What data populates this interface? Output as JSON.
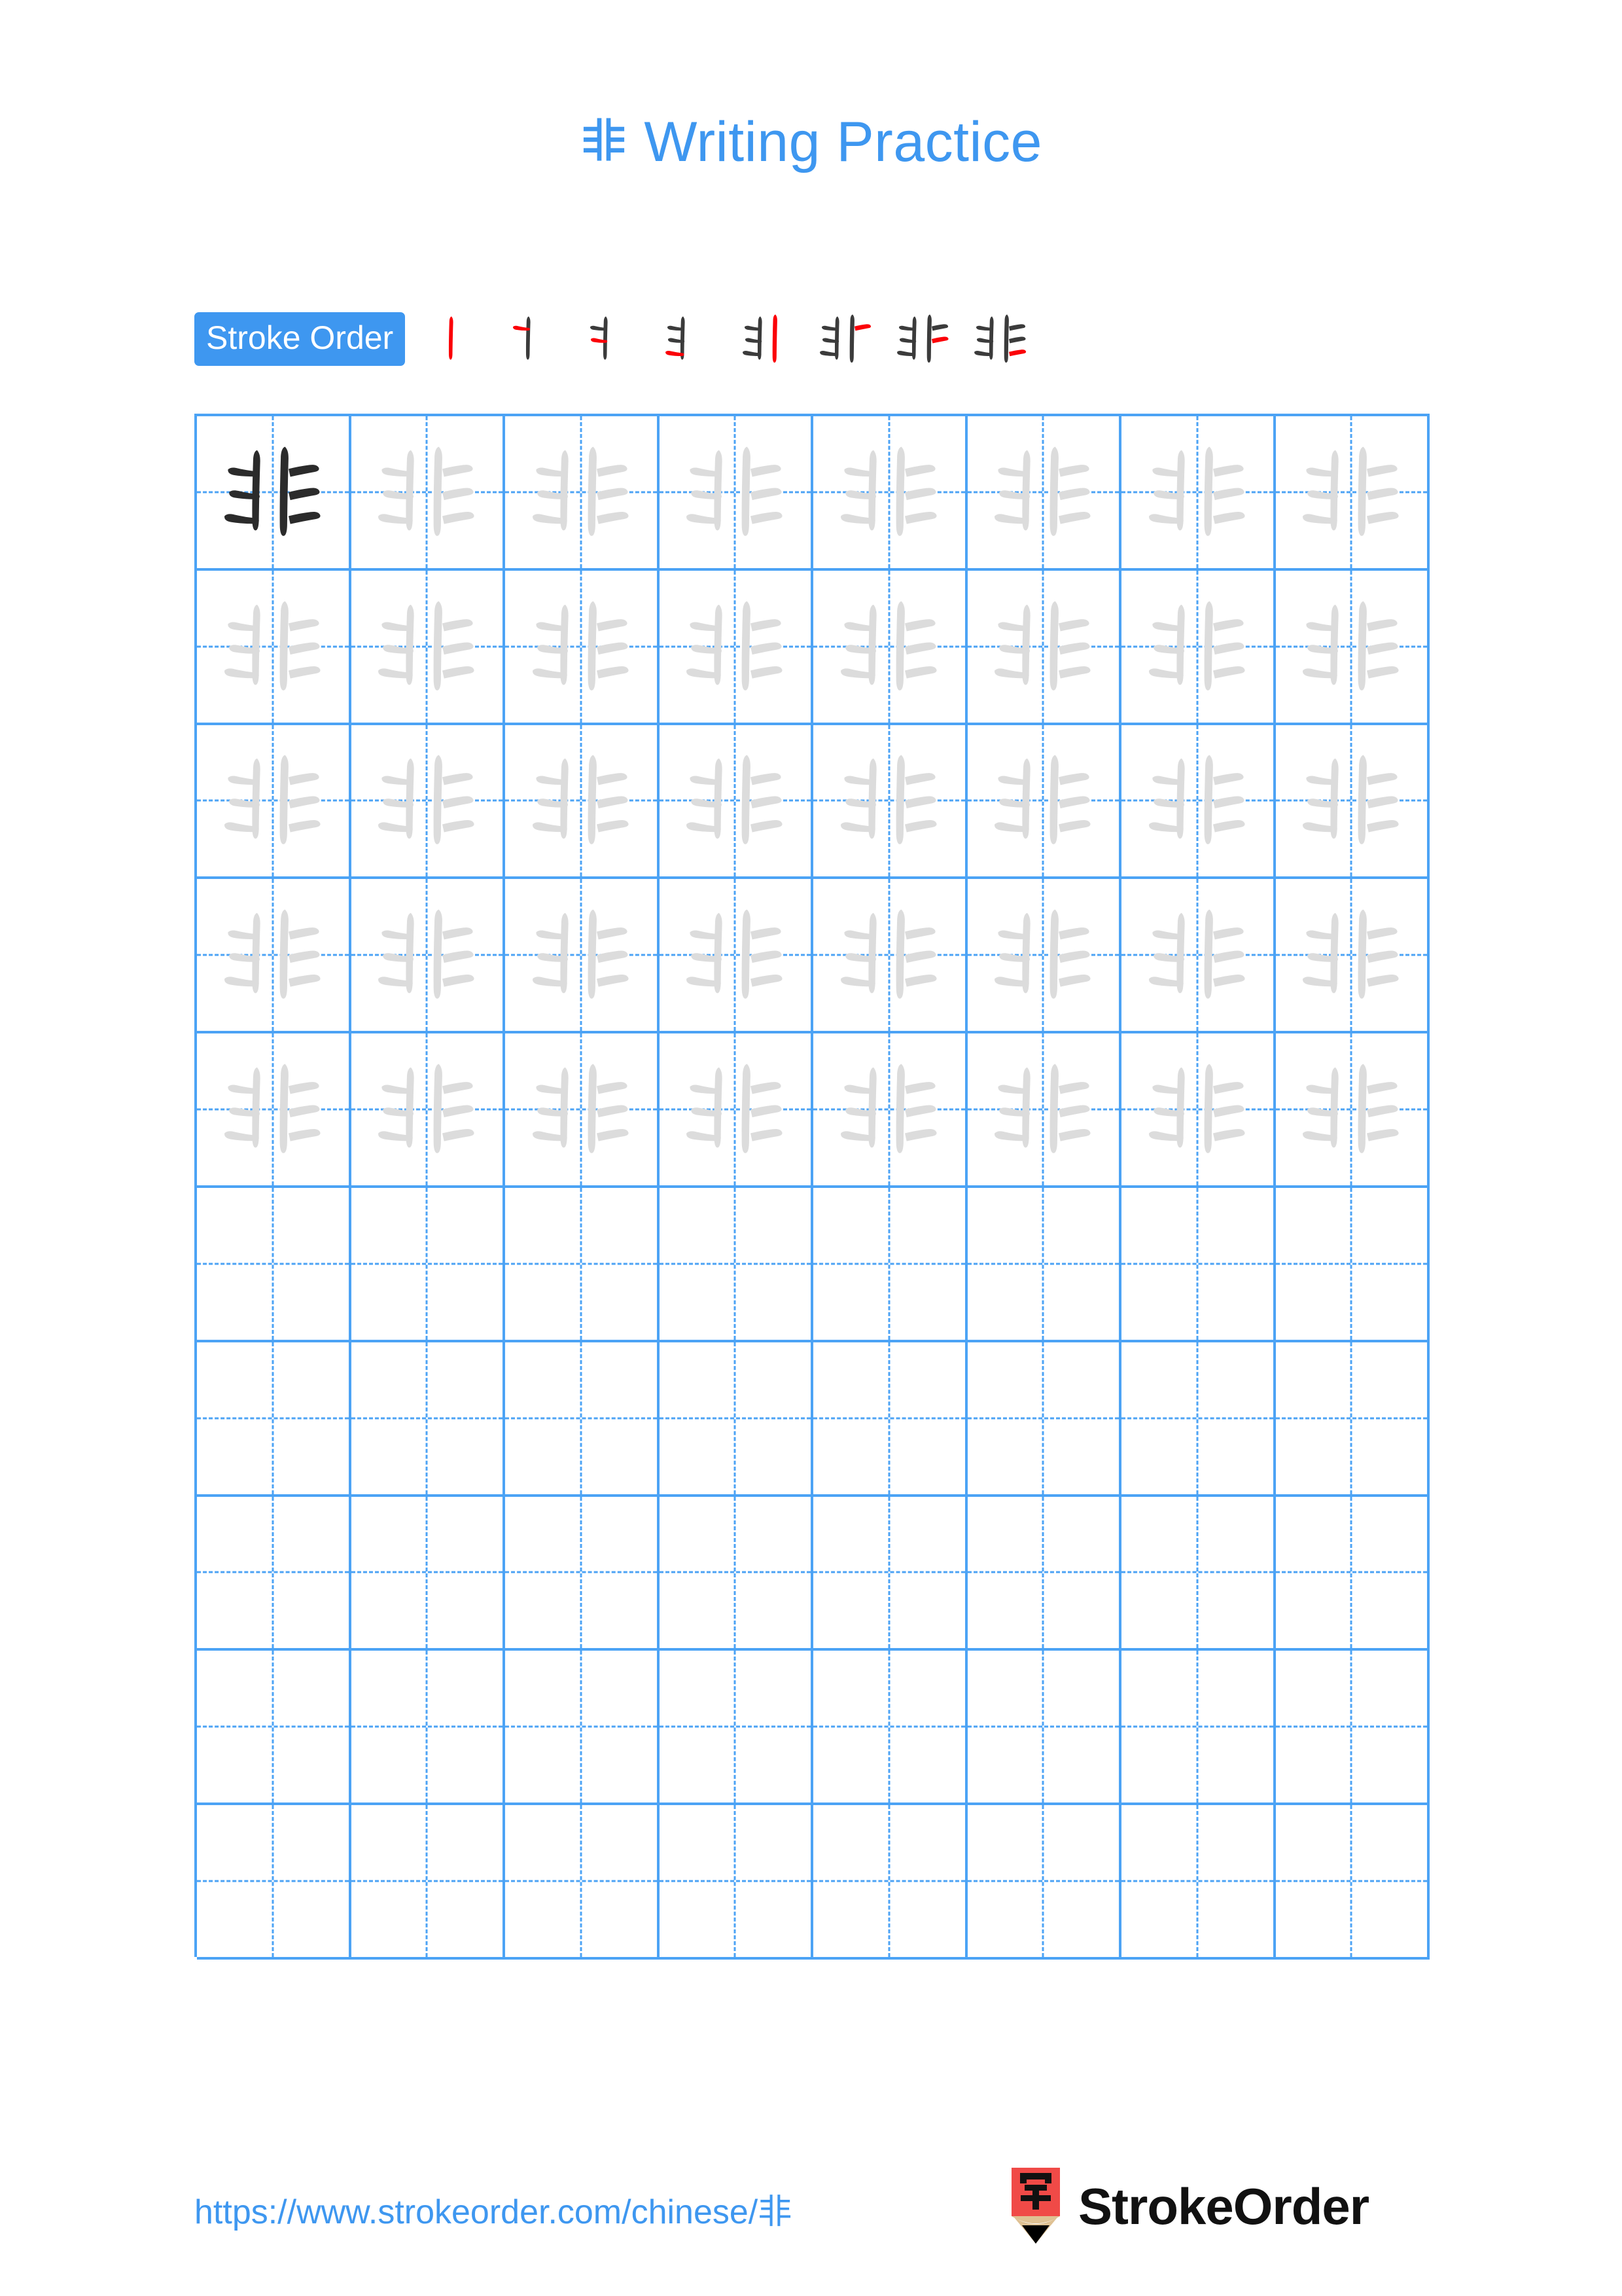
{
  "page": {
    "character": "非",
    "background_color": "#ffffff"
  },
  "title": {
    "character": "非",
    "text": " Writing Practice",
    "full": "非 Writing Practice",
    "color": "#3e97f0"
  },
  "stroke_order": {
    "label": "Stroke Order",
    "badge_color": "#3e97f0",
    "badge_text_color": "#ffffff",
    "total_strokes": 8,
    "ink_color": "#3b3b3b",
    "new_stroke_color": "#fb0007",
    "steps": [
      {
        "index": 1,
        "strokes_shown": 1,
        "new_stroke": "left-vertical"
      },
      {
        "index": 2,
        "strokes_shown": 2,
        "new_stroke": "upper-left-horizontal"
      },
      {
        "index": 3,
        "strokes_shown": 3,
        "new_stroke": "middle-left-horizontal"
      },
      {
        "index": 4,
        "strokes_shown": 4,
        "new_stroke": "lower-left-horizontal"
      },
      {
        "index": 5,
        "strokes_shown": 5,
        "new_stroke": "right-vertical"
      },
      {
        "index": 6,
        "strokes_shown": 6,
        "new_stroke": "upper-right-horizontal"
      },
      {
        "index": 7,
        "strokes_shown": 7,
        "new_stroke": "middle-right-horizontal"
      },
      {
        "index": 8,
        "strokes_shown": 8,
        "new_stroke": "lower-right-horizontal"
      }
    ]
  },
  "grid": {
    "columns": 8,
    "rows": 10,
    "line_color": "#4ca3f5",
    "guide_style": "dashed-crosshair",
    "model_glyph_color": "#2b2b2b",
    "trace_glyph_color": "#dcdcdc",
    "rows_data": [
      {
        "row": 1,
        "cells": [
          "model",
          "trace",
          "trace",
          "trace",
          "trace",
          "trace",
          "trace",
          "trace"
        ]
      },
      {
        "row": 2,
        "cells": [
          "trace",
          "trace",
          "trace",
          "trace",
          "trace",
          "trace",
          "trace",
          "trace"
        ]
      },
      {
        "row": 3,
        "cells": [
          "trace",
          "trace",
          "trace",
          "trace",
          "trace",
          "trace",
          "trace",
          "trace"
        ]
      },
      {
        "row": 4,
        "cells": [
          "trace",
          "trace",
          "trace",
          "trace",
          "trace",
          "trace",
          "trace",
          "trace"
        ]
      },
      {
        "row": 5,
        "cells": [
          "trace",
          "trace",
          "trace",
          "trace",
          "trace",
          "trace",
          "trace",
          "trace"
        ]
      },
      {
        "row": 6,
        "cells": [
          "empty",
          "empty",
          "empty",
          "empty",
          "empty",
          "empty",
          "empty",
          "empty"
        ]
      },
      {
        "row": 7,
        "cells": [
          "empty",
          "empty",
          "empty",
          "empty",
          "empty",
          "empty",
          "empty",
          "empty"
        ]
      },
      {
        "row": 8,
        "cells": [
          "empty",
          "empty",
          "empty",
          "empty",
          "empty",
          "empty",
          "empty",
          "empty"
        ]
      },
      {
        "row": 9,
        "cells": [
          "empty",
          "empty",
          "empty",
          "empty",
          "empty",
          "empty",
          "empty",
          "empty"
        ]
      },
      {
        "row": 10,
        "cells": [
          "empty",
          "empty",
          "empty",
          "empty",
          "empty",
          "empty",
          "empty",
          "empty"
        ]
      }
    ]
  },
  "footer": {
    "url": "https://www.strokeorder.com/chinese/非",
    "url_color": "#3e97f0",
    "brand_name": "StrokeOrder",
    "brand_color": "#111111",
    "logo": {
      "icon": "pencil-logo-icon",
      "body_color": "#f04a47",
      "wood_color": "#dfc193",
      "tip_color": "#000000",
      "glyph": "字"
    }
  }
}
